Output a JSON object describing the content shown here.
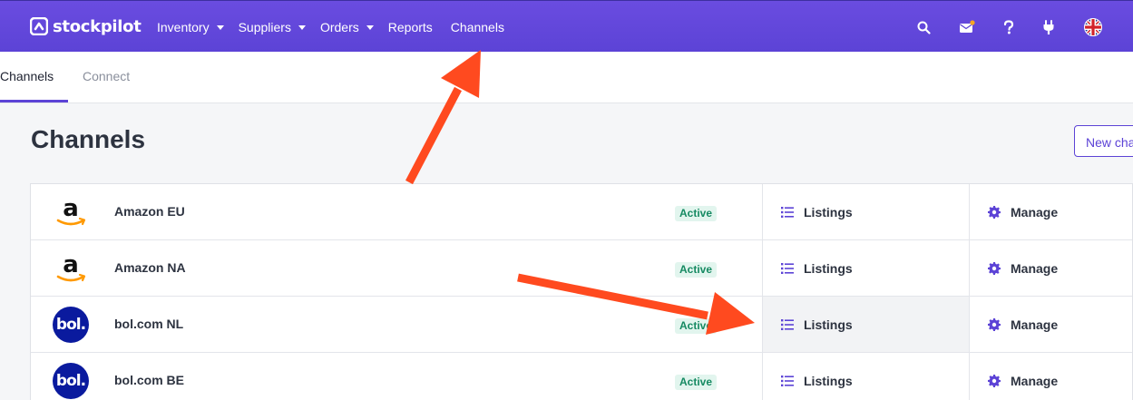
{
  "brand": {
    "name": "stockpilot"
  },
  "nav": [
    {
      "label": "Inventory",
      "dropdown": true
    },
    {
      "label": "Suppliers",
      "dropdown": true
    },
    {
      "label": "Orders",
      "dropdown": true
    },
    {
      "label": "Reports",
      "dropdown": false
    },
    {
      "label": "Channels",
      "dropdown": false
    }
  ],
  "header_icons": [
    "search-icon",
    "mail-icon",
    "help-icon",
    "plug-icon",
    "uk-flag-icon"
  ],
  "tabs": [
    {
      "label": "Channels",
      "active": true
    },
    {
      "label": "Connect",
      "active": false
    }
  ],
  "page": {
    "title": "Channels",
    "new_button_label": "New cha"
  },
  "channels": [
    {
      "logo": "amazon-logo",
      "name": "Amazon EU",
      "status": "Active",
      "listings_label": "Listings",
      "manage_label": "Manage"
    },
    {
      "logo": "amazon-logo",
      "name": "Amazon NA",
      "status": "Active",
      "listings_label": "Listings",
      "manage_label": "Manage"
    },
    {
      "logo": "bol-logo",
      "logo_text": "bol.",
      "name": "bol.com NL",
      "status": "Active",
      "listings_label": "Listings",
      "manage_label": "Manage"
    },
    {
      "logo": "bol-logo",
      "logo_text": "bol.",
      "name": "bol.com BE",
      "status": "Active",
      "listings_label": "Listings",
      "manage_label": "Manage"
    }
  ],
  "colors": {
    "brand": "#5c43d6",
    "active_badge_bg": "#e2f5ee",
    "active_badge_text": "#168a62",
    "annotation_arrow": "#ff4a1f",
    "notification_dot": "#f5a623"
  }
}
